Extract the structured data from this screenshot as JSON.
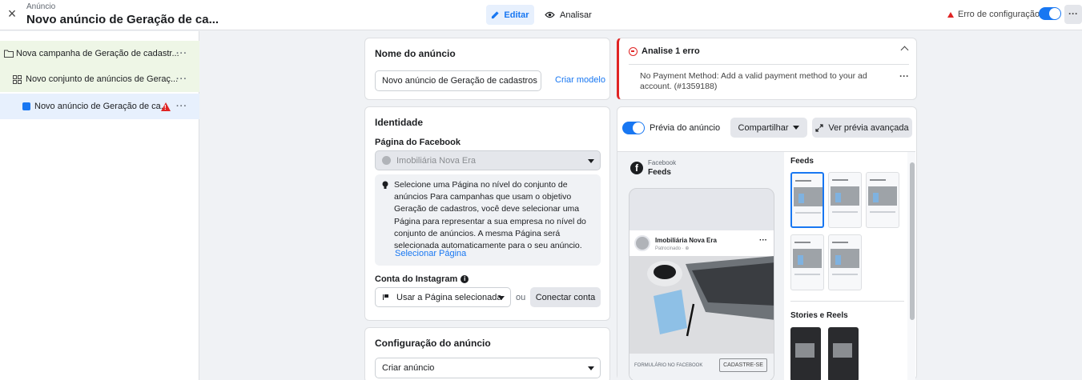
{
  "header": {
    "breadcrumb": "Anúncio",
    "title": "Novo anúncio de Geração de ca...",
    "edit_label": "Editar",
    "analyze_label": "Analisar",
    "config_error": "Erro de configuração",
    "more": "···"
  },
  "sidebar": {
    "items": [
      {
        "label": "Nova campanha de Geração de cadastr...",
        "icon": "folder-icon",
        "more": "···"
      },
      {
        "label": "Novo conjunto de anúncios de Geraç...",
        "icon": "grid-icon",
        "more": "···"
      },
      {
        "label": "Novo anúncio de Geração de ca...",
        "icon": "ad-icon",
        "more": "···"
      }
    ]
  },
  "ad_name": {
    "title": "Nome do anúncio",
    "value": "Novo anúncio de Geração de cadastros",
    "create_template": "Criar modelo"
  },
  "identity": {
    "title": "Identidade",
    "facebook_page_label": "Página do Facebook",
    "facebook_page_value": "Imobiliária Nova Era",
    "info_text": "Selecione uma Página no nível do conjunto de anúncios Para campanhas que usam o objetivo Geração de cadastros, você deve selecionar uma Página para representar a sua empresa no nível do conjunto de anúncios. A mesma Página será selecionada automaticamente para o seu anúncio.",
    "select_page_link": "Selecionar Página",
    "instagram_label": "Conta do Instagram",
    "instagram_value": "Usar a Página selecionada",
    "or": "ou",
    "connect_account": "Conectar conta"
  },
  "ad_config": {
    "title": "Configuração do anúncio",
    "value": "Criar anúncio"
  },
  "errors": {
    "title": "Analise 1 erro",
    "message": "No Payment Method: Add a valid payment method to your ad account. (#1359188)",
    "more": "···"
  },
  "preview": {
    "toggle_label": "Prévia do anúncio",
    "share_label": "Compartilhar",
    "advanced_label": "Ver prévia avançada",
    "platform_small": "Facebook",
    "platform_feed": "Feeds",
    "page_name": "Imobiliária Nova Era",
    "sponsored": "Patrocinado · ⊕",
    "footer_text": "FORMULÁRIO NO FACEBOOK",
    "cta": "CADASTRE-SE",
    "feeds_title": "Feeds",
    "stories_title": "Stories e Reels"
  },
  "colors": {
    "accent": "#1877f2",
    "error": "#e02424"
  }
}
